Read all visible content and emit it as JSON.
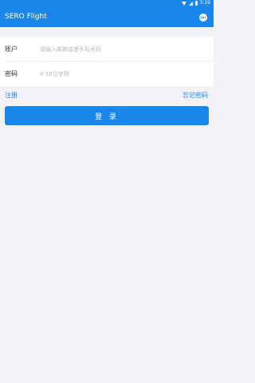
{
  "status_bar": {
    "time": "3:19",
    "icons": [
      "wifi-icon",
      "signal-icon",
      "battery-icon"
    ]
  },
  "app_bar": {
    "title": "SERO Flight",
    "menu_icon": "more-horizontal-icon"
  },
  "form": {
    "account_label": "账户",
    "account_placeholder": "请输入邮箱或者手机号码",
    "account_value": "",
    "password_label": "密码",
    "password_placeholder": "8-18位字符",
    "password_value": ""
  },
  "links": {
    "register": "注册",
    "forgot_password": "忘记密码"
  },
  "login_button": {
    "label": "登 录"
  },
  "colors": {
    "primary": "#1a86ea",
    "background": "#f2f2f7",
    "card": "#ffffff"
  }
}
